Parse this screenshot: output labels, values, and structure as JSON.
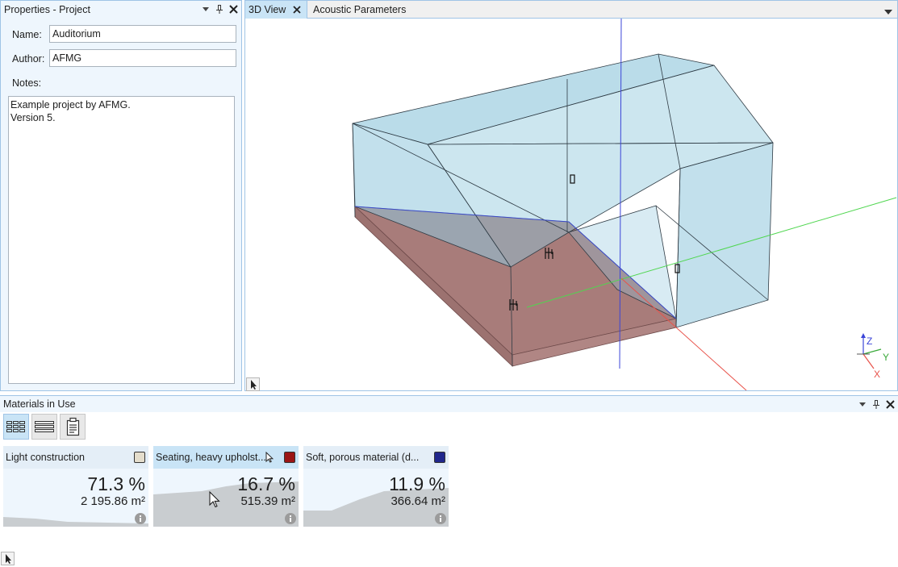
{
  "properties": {
    "title": "Properties - Project",
    "name_label": "Name:",
    "name_value": "Auditorium",
    "author_label": "Author:",
    "author_value": "AFMG",
    "notes_label": "Notes:",
    "notes_value": "Example project by AFMG.\nVersion 5."
  },
  "tabs": [
    {
      "label": "3D View",
      "active": true
    },
    {
      "label": "Acoustic Parameters",
      "active": false
    }
  ],
  "axes": {
    "z": "Z",
    "y": "Y",
    "x": "X"
  },
  "materials": {
    "title": "Materials in Use",
    "items": [
      {
        "name": "Light construction",
        "percent": "71.3 %",
        "area": "2 195.86 m²",
        "color": "#e4ddcc",
        "share": 0.713,
        "selected": false
      },
      {
        "name": "Seating, heavy upholst...",
        "percent": "16.7 %",
        "area": "515.39 m²",
        "color": "#9b1515",
        "share": 0.167,
        "selected": true
      },
      {
        "name": "Soft, porous material (d...",
        "percent": "11.9 %",
        "area": "366.64 m²",
        "color": "#21278c",
        "share": 0.119,
        "selected": false
      }
    ]
  },
  "colors": {
    "accent": "#c9e4f6",
    "panel_bg": "#eef6fd",
    "border": "#9fc4e6",
    "room_fill": "#a7d3e3",
    "floor_fill": "#a47a7a"
  },
  "icons": [
    "dropdown-icon",
    "pin-icon",
    "close-icon",
    "grid-view-icon",
    "list-view-icon",
    "report-view-icon",
    "info-icon",
    "pointer-icon"
  ]
}
